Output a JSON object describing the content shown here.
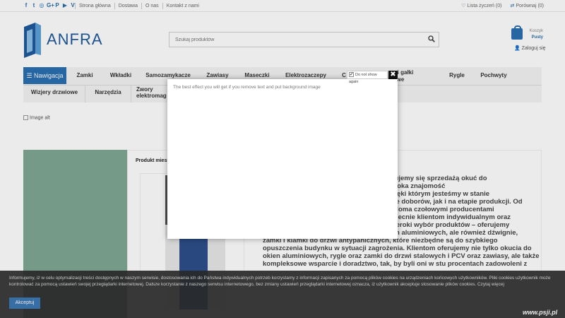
{
  "social": [
    "f",
    "t",
    "◎",
    "G+",
    "P",
    "▶",
    "V"
  ],
  "top_links": [
    "Strona główna",
    "Dostawa",
    "O nas",
    "Kontakt z nami"
  ],
  "top_right": {
    "wishlist": "Lista życzeń (0)",
    "compare": "Porównaj (0)"
  },
  "logo_text": "ANFRA",
  "search": {
    "placeholder": "Szukaj produktów"
  },
  "cart": {
    "label": "Koszyk",
    "status": "Pusty"
  },
  "login": "Zaloguj się",
  "nav": {
    "button": "Nawigacja",
    "row1": [
      "Zamki",
      "Wkładki",
      "Samozamykacze",
      "Zawiasy",
      "Maseczki",
      "Elektrozaczepy",
      "C",
      "i gałki",
      "Rygle",
      "Pochwyty"
    ],
    "row1_sub": "we",
    "row2": [
      "Wizjery drzwiowe",
      "Narzędzia",
      "Zwory",
      "elektromag"
    ]
  },
  "image_alt": "Image alt",
  "product_title": "Produkt miesi",
  "description": [
    "ku lat zajmujemy się sprzedażą okuć do",
    "n atutem jest szeroka znajomość",
    "niczne, dzięki którym jesteśmy w stanie",
    "pie doborów, jak i na etapie produkcji. Od",
    "wieloma czołowymi producentami",
    "obecnie klientom indywidualnym oraz",
    "zeroki wybór produktów – oferujemy",
    "n aluminiowych, ale również dźwignie,",
    "zamki i klamki do drzwi antypanicznych, które niezbędne są do szybkiego",
    "opuszczenia budynku w sytuacji zagrożenia. Klientom oferujemy nie tylko okucia do",
    "okien aluminiowych, rygle oraz zamki do drzwi stalowych i PCV oraz zawiasy, ale także",
    "kompleksowe wsparcie i doradztwo, tak, by byli oni w stu procentach zadowoleni z"
  ],
  "cookie": {
    "text": "Informujemy, iż w celu optymalizacji treści dostępnych w naszym serwisie, dostosowania ich do Państwa indywidualnych potrzeb korzystamy z informacji zapisanych za pomocą plików cookies na urządzeniach końcowych użytkowników. Pliki cookies użytkownik może kontrolować za pomocą ustawień swojej przeglądarki internetowej. Dalsze korzystanie z naszego serwisu internetowego, bez zmiany ustawień przeglądarki internetowej oznacza, iż użytkownik akceptuje stosowanie plików cookies. Czytaj więcej",
    "accept": "Akceptuj"
  },
  "watermark": "www.psji.pl",
  "popup": {
    "message": "The best effect you will get if you remove text and put background image",
    "dont_show": "Do not show again",
    "close": "✖"
  },
  "colors": {
    "accent": "#2a6fb0",
    "green_panel": "#7fa893"
  }
}
